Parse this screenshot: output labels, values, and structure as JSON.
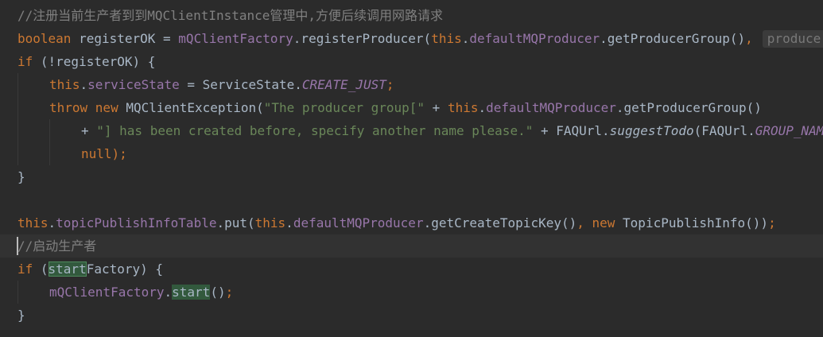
{
  "editor": {
    "lines": [
      {
        "tokens": [
          {
            "t": "//注册当前生产者到到MQClientInstance管理中,方便后续调用网路请求",
            "c": "cmt"
          }
        ]
      },
      {
        "tokens": [
          {
            "t": "boolean",
            "c": "kw"
          },
          {
            "t": " registerOK = ",
            "c": ""
          },
          {
            "t": "mQClientFactory",
            "c": "fld"
          },
          {
            "t": ".registerProducer(",
            "c": ""
          },
          {
            "t": "this",
            "c": "kw"
          },
          {
            "t": ".",
            "c": ""
          },
          {
            "t": "defaultMQProducer",
            "c": "fld"
          },
          {
            "t": ".getProducerGroup()",
            "c": ""
          },
          {
            "t": ",",
            "c": "kw"
          },
          {
            "t": "producer:",
            "c": "hint"
          }
        ]
      },
      {
        "tokens": [
          {
            "t": "if",
            "c": "kw"
          },
          {
            "t": " (!registerOK) {",
            "c": ""
          }
        ]
      },
      {
        "tokens": [
          {
            "t": "this",
            "c": "kw"
          },
          {
            "t": ".",
            "c": ""
          },
          {
            "t": "serviceState",
            "c": "fld"
          },
          {
            "t": " = ServiceState.",
            "c": ""
          },
          {
            "t": "CREATE_JUST",
            "c": "fld it"
          },
          {
            "t": ";",
            "c": "kw"
          }
        ]
      },
      {
        "tokens": [
          {
            "t": "throw new",
            "c": "kw"
          },
          {
            "t": " MQClientException(",
            "c": ""
          },
          {
            "t": "\"The producer group[\"",
            "c": "str"
          },
          {
            "t": " + ",
            "c": ""
          },
          {
            "t": "this",
            "c": "kw"
          },
          {
            "t": ".",
            "c": ""
          },
          {
            "t": "defaultMQProducer",
            "c": "fld"
          },
          {
            "t": ".getProducerGroup()",
            "c": ""
          }
        ]
      },
      {
        "tokens": [
          {
            "t": "+ ",
            "c": ""
          },
          {
            "t": "\"] has been created before, specify another name please.\"",
            "c": "str"
          },
          {
            "t": " + FAQUrl.",
            "c": ""
          },
          {
            "t": "suggestTodo",
            "c": "it"
          },
          {
            "t": "(FAQUrl.",
            "c": ""
          },
          {
            "t": "GROUP_NAME_DUPLICATE_URL",
            "c": "fld it"
          }
        ]
      },
      {
        "tokens": [
          {
            "t": "null",
            "c": "kw"
          },
          {
            "t": ");",
            "c": "kw"
          }
        ]
      },
      {
        "tokens": [
          {
            "t": "}",
            "c": ""
          }
        ]
      },
      {
        "tokens": []
      },
      {
        "tokens": [
          {
            "t": "this",
            "c": "kw"
          },
          {
            "t": ".",
            "c": ""
          },
          {
            "t": "topicPublishInfoTable",
            "c": "fld"
          },
          {
            "t": ".put(",
            "c": ""
          },
          {
            "t": "this",
            "c": "kw"
          },
          {
            "t": ".",
            "c": ""
          },
          {
            "t": "defaultMQProducer",
            "c": "fld"
          },
          {
            "t": ".getCreateTopicKey()",
            "c": ""
          },
          {
            "t": ", new",
            "c": "kw"
          },
          {
            "t": " TopicPublishInfo())",
            "c": ""
          },
          {
            "t": ";",
            "c": "kw"
          }
        ]
      },
      {
        "tokens": [
          {
            "t": "//启动生产者",
            "c": "cmt"
          }
        ]
      },
      {
        "tokens": [
          {
            "t": "if",
            "c": "kw"
          },
          {
            "t": " (",
            "c": ""
          },
          {
            "t": "start",
            "c": "hl-box"
          },
          {
            "t": "Factory) {",
            "c": ""
          }
        ]
      },
      {
        "tokens": [
          {
            "t": "mQClientFactory",
            "c": "fld"
          },
          {
            "t": ".",
            "c": ""
          },
          {
            "t": "start",
            "c": "hl"
          },
          {
            "t": "()",
            "c": ""
          },
          {
            "t": ";",
            "c": "kw"
          }
        ]
      },
      {
        "tokens": [
          {
            "t": "}",
            "c": ""
          }
        ]
      }
    ]
  }
}
